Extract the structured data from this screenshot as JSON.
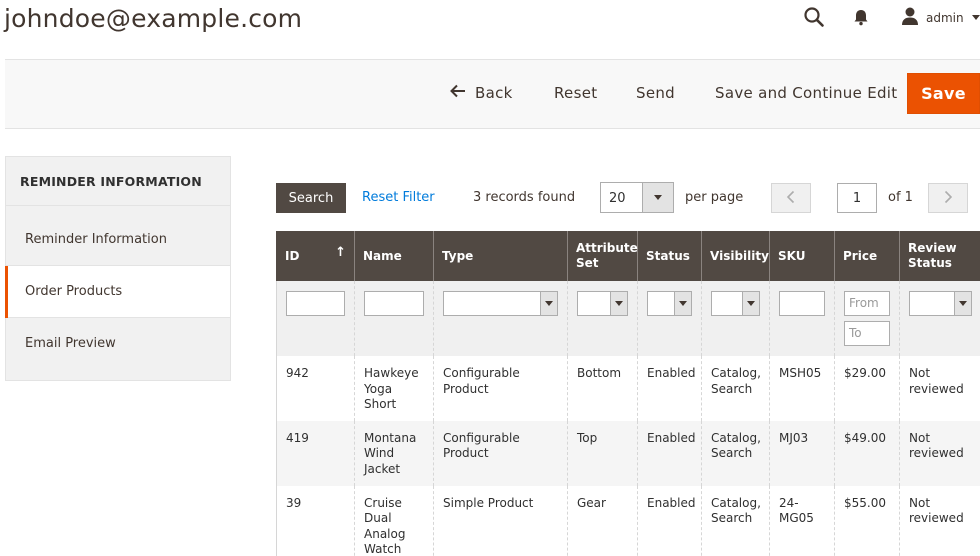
{
  "header": {
    "title": "johndoe@example.com",
    "user_label": "admin"
  },
  "actions": {
    "back": "Back",
    "reset": "Reset",
    "send": "Send",
    "save_continue": "Save and Continue Edit",
    "save": "Save"
  },
  "sidenav": {
    "title": "REMINDER INFORMATION",
    "items": [
      {
        "label": "Reminder Information"
      },
      {
        "label": "Order Products"
      },
      {
        "label": "Email Preview"
      }
    ]
  },
  "toolbar": {
    "search_label": "Search",
    "reset_filter_label": "Reset Filter",
    "records_found": "3 records found",
    "per_page_value": "20",
    "per_page_label": "per page",
    "page_value": "1",
    "of_total": "of 1"
  },
  "grid": {
    "columns": [
      "ID",
      "Name",
      "Type",
      "Attribute Set",
      "Status",
      "Visibility",
      "SKU",
      "Price",
      "Review Status"
    ],
    "sort_indicator": "↑",
    "filters": {
      "price_from_placeholder": "From",
      "price_to_placeholder": "To"
    },
    "rows": [
      {
        "id": "942",
        "name": "Hawkeye Yoga Short",
        "type": "Configurable Product",
        "attribute_set": "Bottom",
        "status": "Enabled",
        "visibility": "Catalog, Search",
        "sku": "MSH05",
        "price": "$29.00",
        "review_status": "Not reviewed"
      },
      {
        "id": "419",
        "name": "Montana Wind Jacket",
        "type": "Configurable Product",
        "attribute_set": "Top",
        "status": "Enabled",
        "visibility": "Catalog, Search",
        "sku": "MJ03",
        "price": "$49.00",
        "review_status": "Not reviewed"
      },
      {
        "id": "39",
        "name": "Cruise Dual Analog Watch",
        "type": "Simple Product",
        "attribute_set": "Gear",
        "status": "Enabled",
        "visibility": "Catalog, Search",
        "sku": "24-MG05",
        "price": "$55.00",
        "review_status": "Not reviewed"
      }
    ]
  },
  "colors": {
    "accent": "#eb5202",
    "header_bg": "#514943",
    "link": "#007bdb"
  },
  "icons": {
    "search": "search-icon",
    "notifications": "bell-icon",
    "user": "user-icon",
    "back": "arrow-left-icon"
  }
}
